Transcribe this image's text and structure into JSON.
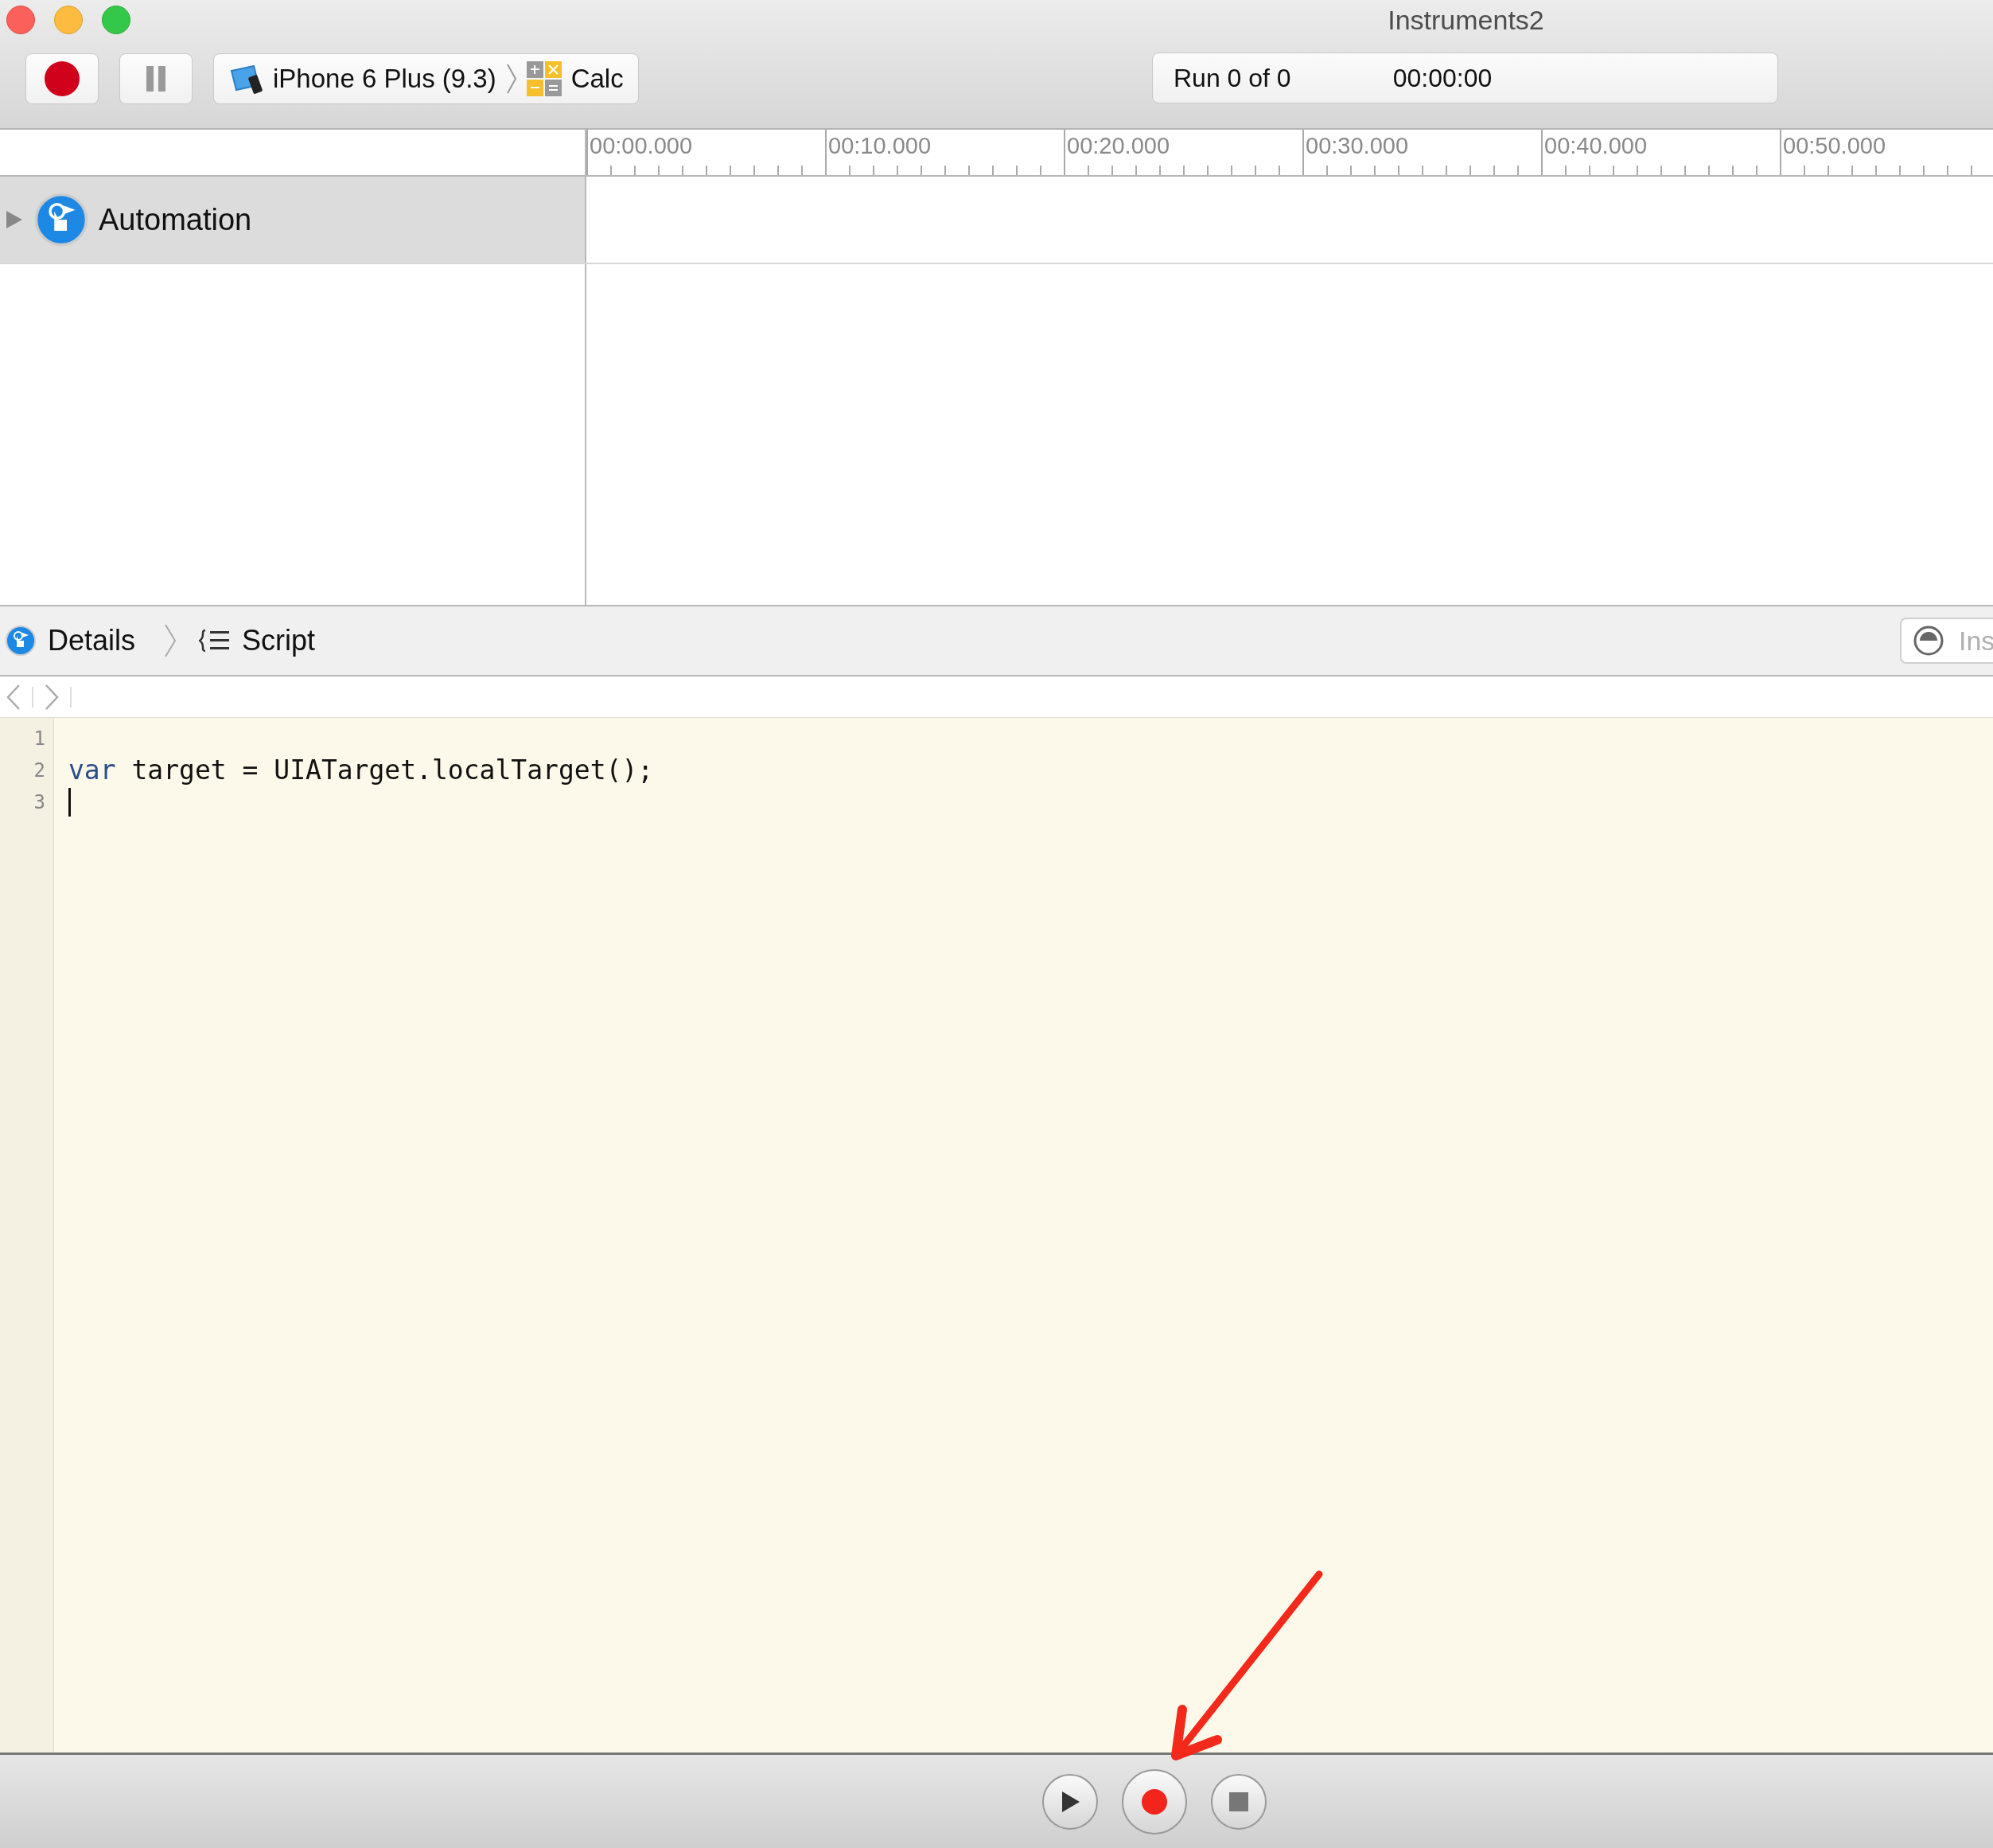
{
  "window": {
    "title": "Instruments2"
  },
  "toolbar": {
    "target_device": "iPhone 6 Plus (9.3)",
    "target_app": "Calc",
    "run_status": "Run 0 of 0",
    "elapsed_time": "00:00:00"
  },
  "timeline": {
    "ruler_labels": [
      "00:00.000",
      "00:10.000",
      "00:20.000",
      "00:30.000",
      "00:40.000",
      "00:50.000"
    ],
    "tracks": [
      {
        "name": "Automation",
        "expanded": false,
        "selected": true
      }
    ]
  },
  "detail_bar": {
    "breadcrumbs": [
      {
        "kind": "instrument",
        "label": "Details"
      },
      {
        "kind": "script",
        "label": "Script"
      }
    ],
    "search": {
      "placeholder": "Ins"
    }
  },
  "editor": {
    "lines": [
      {
        "number": "1",
        "cursor": false
      },
      {
        "number": "2",
        "cursor": false,
        "tokens": [
          {
            "kind": "keyword",
            "text": "var"
          },
          {
            "kind": "plain",
            "text": " target = UIATarget.localTarget();"
          }
        ]
      },
      {
        "number": "3",
        "cursor": true
      }
    ]
  },
  "transport": [
    {
      "kind": "play"
    },
    {
      "kind": "record"
    },
    {
      "kind": "stop"
    }
  ]
}
